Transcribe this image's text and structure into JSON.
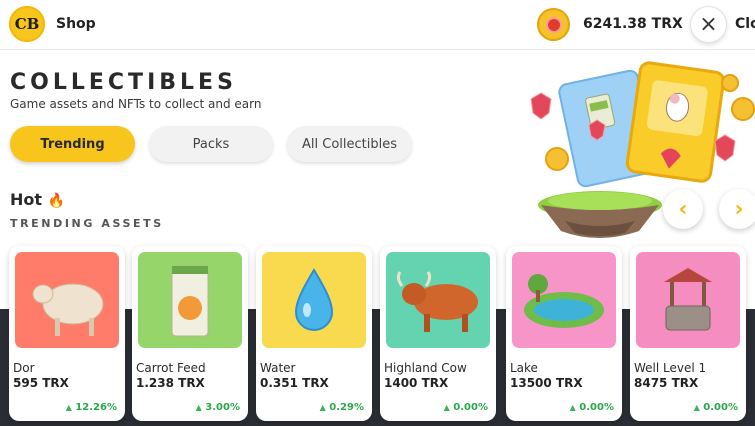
{
  "header": {
    "logo_text": "CB",
    "title": "Shop",
    "balance": "6241.38 TRX",
    "close_icon": "×",
    "close_label": "Clo"
  },
  "hero": {
    "title": "COLLECTIBLES",
    "subtitle": "Game assets and NFTs to collect and earn",
    "prev_icon": "‹",
    "next_icon": "›"
  },
  "tabs": [
    {
      "label": "Trending",
      "active": true
    },
    {
      "label": "Packs",
      "active": false
    },
    {
      "label": "All Collectibles",
      "active": false
    }
  ],
  "section": {
    "hot_label": "Hot",
    "hot_icon": "🔥",
    "trending_label": "TRENDING ASSETS",
    "up_icon": "▲"
  },
  "assets": [
    {
      "name": "Dor",
      "price": "595 TRX",
      "change": "12.26%",
      "bg": "#ff7c6b",
      "icon": "sheep-icon"
    },
    {
      "name": "Carrot Feed",
      "price": "1.238 TRX",
      "change": "3.00%",
      "bg": "#95d569",
      "icon": "carrot-feed-bag-icon"
    },
    {
      "name": "Water",
      "price": "0.351 TRX",
      "change": "0.29%",
      "bg": "#f9d94d",
      "icon": "water-drop-icon"
    },
    {
      "name": "Highland Cow",
      "price": "1400 TRX",
      "change": "0.00%",
      "bg": "#63d3b0",
      "icon": "highland-cow-icon"
    },
    {
      "name": "Lake",
      "price": "13500 TRX",
      "change": "0.00%",
      "bg": "#f795c9",
      "icon": "lake-icon"
    },
    {
      "name": "Well Level 1",
      "price": "8475 TRX",
      "change": "0.00%",
      "bg": "#f58dc1",
      "icon": "well-icon"
    }
  ]
}
